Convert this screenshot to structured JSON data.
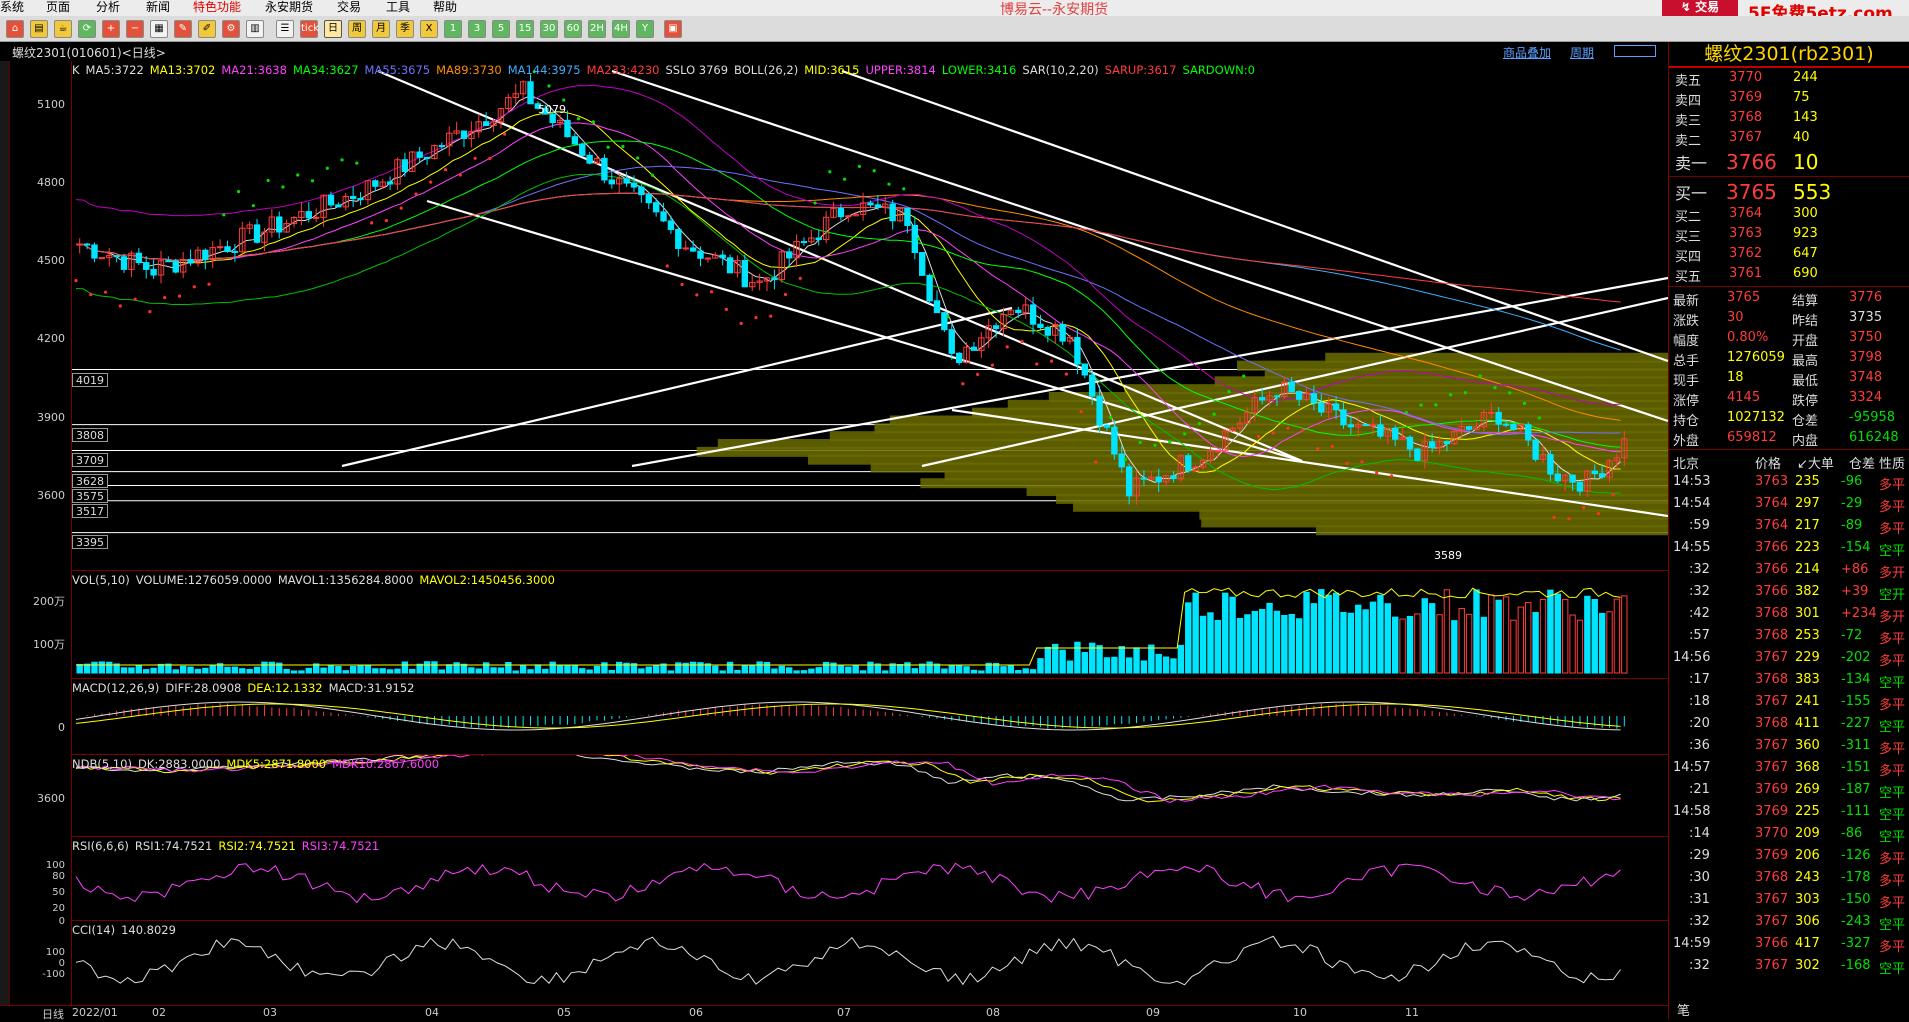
{
  "menu": {
    "items": [
      "系统",
      "页面",
      "分析",
      "新闻",
      "特色功能",
      "永安期货",
      "交易",
      "工具",
      "帮助"
    ],
    "app_title": "博易云--永安期货",
    "trade_btn": "交易",
    "watermark": "5E免费5etz.com"
  },
  "toolbar": {
    "icons": [
      "home-icon",
      "folder-icon",
      "cup-icon",
      "refresh-icon",
      "zoom-in-icon",
      "zoom-out-icon",
      "layout-icon",
      "pencil-icon",
      "paint-icon",
      "settings-icon",
      "grid-icon",
      "menu-icon",
      "tick-icon",
      "day-icon",
      "week-icon",
      "month-icon",
      "season-icon",
      "x-icon",
      "one-icon",
      "three-icon",
      "five-icon",
      "fifteen-icon",
      "thirty-icon",
      "sixty-icon",
      "two-h-icon",
      "four-h-icon",
      "year-icon",
      "calc-icon"
    ],
    "labels": {
      "tick": "tick",
      "day": "日",
      "week": "周",
      "month": "月",
      "season": "季",
      "x": "X",
      "m1": "1",
      "m3": "3",
      "m5": "5",
      "m15": "15",
      "m30": "30",
      "m60": "60",
      "h2": "2H",
      "h4": "4H",
      "year": "Y"
    }
  },
  "chart": {
    "symbol_title": "螺纹2301(010601)<日线>",
    "overlay_link": "商品叠加",
    "cycle_link": "周期"
  },
  "kpanel": {
    "indicators": [
      {
        "t": "K",
        "c": "#dddddd"
      },
      {
        "t": "MA5:3722",
        "c": "#dddddd"
      },
      {
        "t": "MA13:3702",
        "c": "#ffff00"
      },
      {
        "t": "MA21:3638",
        "c": "#ff40ff"
      },
      {
        "t": "MA34:3627",
        "c": "#00ff00"
      },
      {
        "t": "MA55:3675",
        "c": "#7070ff"
      },
      {
        "t": "MA89:3730",
        "c": "#ff8c00"
      },
      {
        "t": "MA144:3975",
        "c": "#3ab0ff"
      },
      {
        "t": "MA233:4230",
        "c": "#ff3c3c"
      },
      {
        "t": "SSLO 3769",
        "c": "#dddddd"
      },
      {
        "t": "BOLL(26,2)",
        "c": "#dddddd"
      },
      {
        "t": "MID:3615",
        "c": "#ffff00"
      },
      {
        "t": "UPPER:3814",
        "c": "#ff40ff"
      },
      {
        "t": "LOWER:3416",
        "c": "#00ff00"
      },
      {
        "t": "SAR(10,2,20)",
        "c": "#dddddd"
      },
      {
        "t": "SARUP:3617",
        "c": "#ff3c3c"
      },
      {
        "t": "SARDOWN:0",
        "c": "#00ff00"
      }
    ],
    "yaxis": [
      "5100",
      "4800",
      "4500",
      "4200",
      "3900",
      "3600"
    ],
    "levels": [
      "4019",
      "3808",
      "3709",
      "3628",
      "3575",
      "3517",
      "3395"
    ],
    "hi_label": "5079",
    "lo_label": "3589"
  },
  "volpanel": {
    "indicators": [
      {
        "t": "VOL(5,10)",
        "c": "#dddddd"
      },
      {
        "t": "VOLUME:1276059.0000",
        "c": "#dddddd"
      },
      {
        "t": "MAVOL1:1356284.8000",
        "c": "#dddddd"
      },
      {
        "t": "MAVOL2:1450456.3000",
        "c": "#ffff00"
      }
    ],
    "yaxis": [
      "200万",
      "100万"
    ]
  },
  "macdpanel": {
    "indicators": [
      {
        "t": "MACD(12,26,9)",
        "c": "#dddddd"
      },
      {
        "t": "DIFF:28.0908",
        "c": "#dddddd"
      },
      {
        "t": "DEA:12.1332",
        "c": "#ffff00"
      },
      {
        "t": "MACD:31.9152",
        "c": "#dddddd"
      }
    ],
    "yaxis": [
      "0"
    ]
  },
  "ndbpanel": {
    "indicators": [
      {
        "t": "NDB(5,10)",
        "c": "#dddddd"
      },
      {
        "t": "DK:2883.0000",
        "c": "#dddddd"
      },
      {
        "t": "MDK5:2871.8000",
        "c": "#ffff00"
      },
      {
        "t": "MDK10:2867.6000",
        "c": "#ff40ff"
      }
    ],
    "yaxis": [
      "3600"
    ]
  },
  "rsipanel": {
    "indicators": [
      {
        "t": "RSI(6,6,6)",
        "c": "#dddddd"
      },
      {
        "t": "RSI1:74.7521",
        "c": "#dddddd"
      },
      {
        "t": "RSI2:74.7521",
        "c": "#ffff00"
      },
      {
        "t": "RSI3:74.7521",
        "c": "#ff40ff"
      }
    ],
    "yaxis": [
      "100",
      "80",
      "50",
      "20",
      "0"
    ]
  },
  "ccipanel": {
    "indicators": [
      {
        "t": "CCI(14)",
        "c": "#dddddd"
      },
      {
        "t": "140.8029",
        "c": "#dddddd"
      }
    ],
    "yaxis": [
      "100",
      "0",
      "-100"
    ]
  },
  "xaxis": {
    "label": "日线",
    "ticks": [
      "2022/01",
      "02",
      "03",
      "04",
      "05",
      "06",
      "07",
      "08",
      "09",
      "10",
      "11"
    ]
  },
  "quote": {
    "title": "螺纹2301(rb2301)",
    "asks": [
      [
        "卖五",
        "3770",
        "244"
      ],
      [
        "卖四",
        "3769",
        "75"
      ],
      [
        "卖三",
        "3768",
        "143"
      ],
      [
        "卖二",
        "3767",
        "40"
      ],
      [
        "卖一",
        "3766",
        "10"
      ]
    ],
    "bids": [
      [
        "买一",
        "3765",
        "553"
      ],
      [
        "买二",
        "3764",
        "300"
      ],
      [
        "买三",
        "3763",
        "923"
      ],
      [
        "买四",
        "3762",
        "647"
      ],
      [
        "买五",
        "3761",
        "690"
      ]
    ],
    "stats": [
      [
        "最新",
        "3765",
        "结算",
        "3776"
      ],
      [
        "涨跌",
        "30",
        "昨结",
        "3735"
      ],
      [
        "幅度",
        "0.80%",
        "开盘",
        "3750"
      ],
      [
        "总手",
        "1276059",
        "最高",
        "3798"
      ],
      [
        "现手",
        "18",
        "最低",
        "3748"
      ],
      [
        "涨停",
        "4145",
        "跌停",
        "3324"
      ],
      [
        "持仓",
        "1027132",
        "仓差",
        "-95958"
      ],
      [
        "外盘",
        "659812",
        "内盘",
        "616248"
      ]
    ],
    "ticks_header": [
      "北京",
      "价格",
      "↙大单",
      "仓差",
      "性质"
    ],
    "ticks": [
      [
        "14:53",
        "3763",
        "235",
        "-96",
        "多平"
      ],
      [
        "14:54",
        "3764",
        "297",
        "-29",
        "多平"
      ],
      [
        ":59",
        "3764",
        "217",
        "-89",
        "多平"
      ],
      [
        "14:55",
        "3766",
        "223",
        "-154",
        "空平"
      ],
      [
        ":32",
        "3766",
        "214",
        "+86",
        "多开"
      ],
      [
        ":32",
        "3766",
        "382",
        "+39",
        "空开"
      ],
      [
        ":42",
        "3768",
        "301",
        "+234",
        "多开"
      ],
      [
        ":57",
        "3768",
        "253",
        "-72",
        "多平"
      ],
      [
        "14:56",
        "3767",
        "229",
        "-202",
        "多平"
      ],
      [
        ":17",
        "3768",
        "383",
        "-134",
        "空平"
      ],
      [
        ":18",
        "3767",
        "241",
        "-155",
        "多平"
      ],
      [
        ":20",
        "3768",
        "411",
        "-227",
        "空平"
      ],
      [
        ":36",
        "3767",
        "360",
        "-311",
        "多平"
      ],
      [
        "14:57",
        "3767",
        "368",
        "-151",
        "多平"
      ],
      [
        ":21",
        "3769",
        "269",
        "-187",
        "空平"
      ],
      [
        "14:58",
        "3769",
        "225",
        "-111",
        "空平"
      ],
      [
        ":14",
        "3770",
        "209",
        "-86",
        "空平"
      ],
      [
        ":29",
        "3769",
        "206",
        "-126",
        "多平"
      ],
      [
        ":30",
        "3768",
        "243",
        "-178",
        "多平"
      ],
      [
        ":31",
        "3767",
        "303",
        "-150",
        "多平"
      ],
      [
        ":32",
        "3767",
        "306",
        "-243",
        "空平"
      ],
      [
        "14:59",
        "3766",
        "417",
        "-327",
        "多平"
      ],
      [
        ":32",
        "3767",
        "302",
        "-168",
        "空平"
      ]
    ],
    "tick_footer": "笔"
  }
}
